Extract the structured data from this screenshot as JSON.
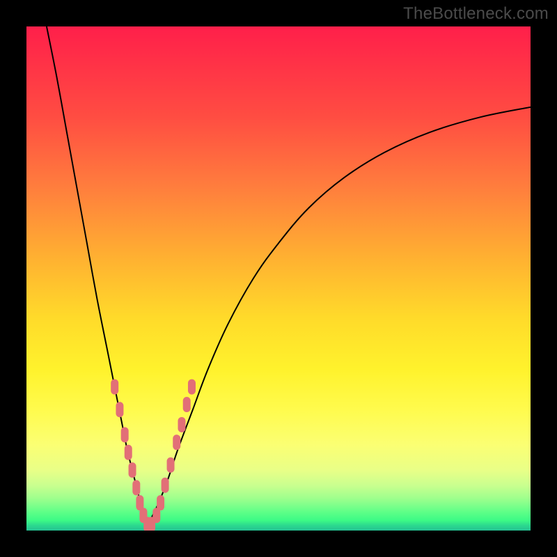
{
  "watermark": "TheBottleneck.com",
  "colors": {
    "background_frame": "#000000",
    "gradient_stops": [
      "#ff1f4a",
      "#ff4d42",
      "#ff7e3d",
      "#ffb131",
      "#ffdb2a",
      "#fff22c",
      "#fffb4d",
      "#fbff73",
      "#e9ff87",
      "#caff8f",
      "#a0ff8d",
      "#7eff8b",
      "#5aff87",
      "#3cfa86",
      "#2cd88e",
      "#24c292"
    ],
    "curve_stroke": "#000000",
    "marker_fill": "#e26f77"
  },
  "chart_data": {
    "type": "line",
    "title": "",
    "xlabel": "",
    "ylabel": "",
    "xlim": [
      0,
      100
    ],
    "ylim": [
      0,
      100
    ],
    "note": "Bottleneck-style V curve. x is arbitrary 0–100; y=0 at bottom (optimal). Minimum near x≈24.",
    "series": [
      {
        "name": "left-branch",
        "x": [
          4,
          6,
          8,
          10,
          12,
          14,
          16,
          18,
          19,
          20,
          21,
          22,
          23,
          24
        ],
        "y": [
          100,
          90,
          79,
          68,
          57,
          46,
          36,
          26,
          21,
          16,
          12,
          8,
          4,
          1
        ]
      },
      {
        "name": "right-branch",
        "x": [
          24,
          26,
          28,
          30,
          33,
          36,
          40,
          45,
          50,
          56,
          63,
          71,
          80,
          90,
          100
        ],
        "y": [
          1,
          5,
          10,
          16,
          24,
          32,
          41,
          50,
          57,
          64,
          70,
          75,
          79,
          82,
          84
        ]
      }
    ],
    "markers": {
      "name": "highlighted-points",
      "comment": "salmon rounded markers near trough region",
      "points": [
        {
          "x": 17.5,
          "y": 28.5
        },
        {
          "x": 18.5,
          "y": 24
        },
        {
          "x": 19.5,
          "y": 19
        },
        {
          "x": 20.2,
          "y": 15.5
        },
        {
          "x": 21.0,
          "y": 12
        },
        {
          "x": 21.8,
          "y": 8.5
        },
        {
          "x": 22.5,
          "y": 5.5
        },
        {
          "x": 23.2,
          "y": 3
        },
        {
          "x": 24.0,
          "y": 1.2
        },
        {
          "x": 24.8,
          "y": 1.2
        },
        {
          "x": 25.8,
          "y": 3
        },
        {
          "x": 26.6,
          "y": 5.5
        },
        {
          "x": 27.5,
          "y": 9
        },
        {
          "x": 28.6,
          "y": 13
        },
        {
          "x": 29.8,
          "y": 17.5
        },
        {
          "x": 30.8,
          "y": 21
        },
        {
          "x": 31.8,
          "y": 25
        },
        {
          "x": 32.8,
          "y": 28.5
        }
      ]
    }
  }
}
